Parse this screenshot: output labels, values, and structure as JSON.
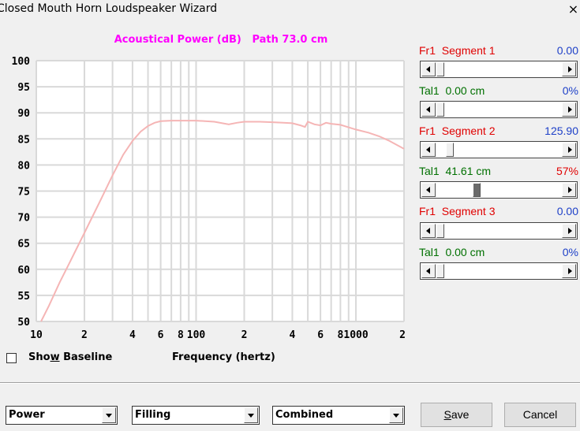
{
  "window": {
    "title": "Closed Mouth Horn Loudspeaker Wizard",
    "close_glyph": "×"
  },
  "chart": {
    "title": "Acoustical Power (dB)   Path 73.0 cm",
    "xlabel": "Frequency (hertz)",
    "ytick_labels": [
      "100",
      "95",
      "90",
      "85",
      "80",
      "75",
      "70",
      "65",
      "60",
      "55",
      "50"
    ],
    "xtick_labels": [
      "10",
      "2",
      "4",
      "6",
      "8",
      "100",
      "2",
      "4",
      "6",
      "8",
      "1000",
      "2"
    ],
    "line_color": "#f5b5b5",
    "grid_color": "#d9d9d9"
  },
  "chart_data": {
    "type": "line",
    "title": "Acoustical Power (dB)   Path 73.0 cm",
    "xlabel": "Frequency (hertz)",
    "ylabel": "",
    "xscale": "log",
    "xlim": [
      10,
      2000
    ],
    "ylim": [
      50,
      100
    ],
    "grid": true,
    "series": [
      {
        "x": [
          10.7,
          12,
          14,
          16,
          20,
          25,
          30,
          35,
          40,
          45,
          50,
          55,
          60,
          70,
          80,
          100,
          130,
          160,
          180,
          200,
          250,
          300,
          350,
          400,
          450,
          480,
          500,
          550,
          600,
          650,
          700,
          800,
          1000,
          1200,
          1400,
          1600,
          2000
        ],
        "y": [
          50,
          53,
          57.5,
          61,
          67,
          73,
          78,
          82,
          84.6,
          86.4,
          87.5,
          88.1,
          88.4,
          88.5,
          88.5,
          88.5,
          88.3,
          87.8,
          88.1,
          88.3,
          88.3,
          88.2,
          88.1,
          88,
          87.6,
          87.3,
          88.3,
          87.8,
          87.6,
          88.1,
          87.9,
          87.7,
          86.8,
          86.2,
          85.5,
          84.7,
          83.1
        ]
      }
    ]
  },
  "panel": {
    "rows": [
      {
        "label": "Fr1  Segment 1",
        "value": "0.00",
        "thumb": 0.0
      },
      {
        "label": "Tal1  0.00 cm",
        "value": "0%",
        "thumb": 0.0
      },
      {
        "label": "Fr1  Segment 2",
        "value": "125.90",
        "thumb": 0.08
      },
      {
        "label": "Tal1  41.61 cm",
        "value": "57%",
        "thumb": 0.31
      },
      {
        "label": "Fr1  Segment 3",
        "value": "0.00",
        "thumb": 0.0
      },
      {
        "label": "Tal1  0.00 cm",
        "value": "0%",
        "thumb": 0.0
      }
    ]
  },
  "checkbox": {
    "pre": "Sho",
    "underlined": "w",
    "post": " Baseline",
    "checked": false
  },
  "bottom": {
    "combo1": "Power",
    "combo2": "Filling",
    "combo3": "Combined",
    "save_underlined": "S",
    "save_rest": "ave",
    "cancel": "Cancel"
  }
}
